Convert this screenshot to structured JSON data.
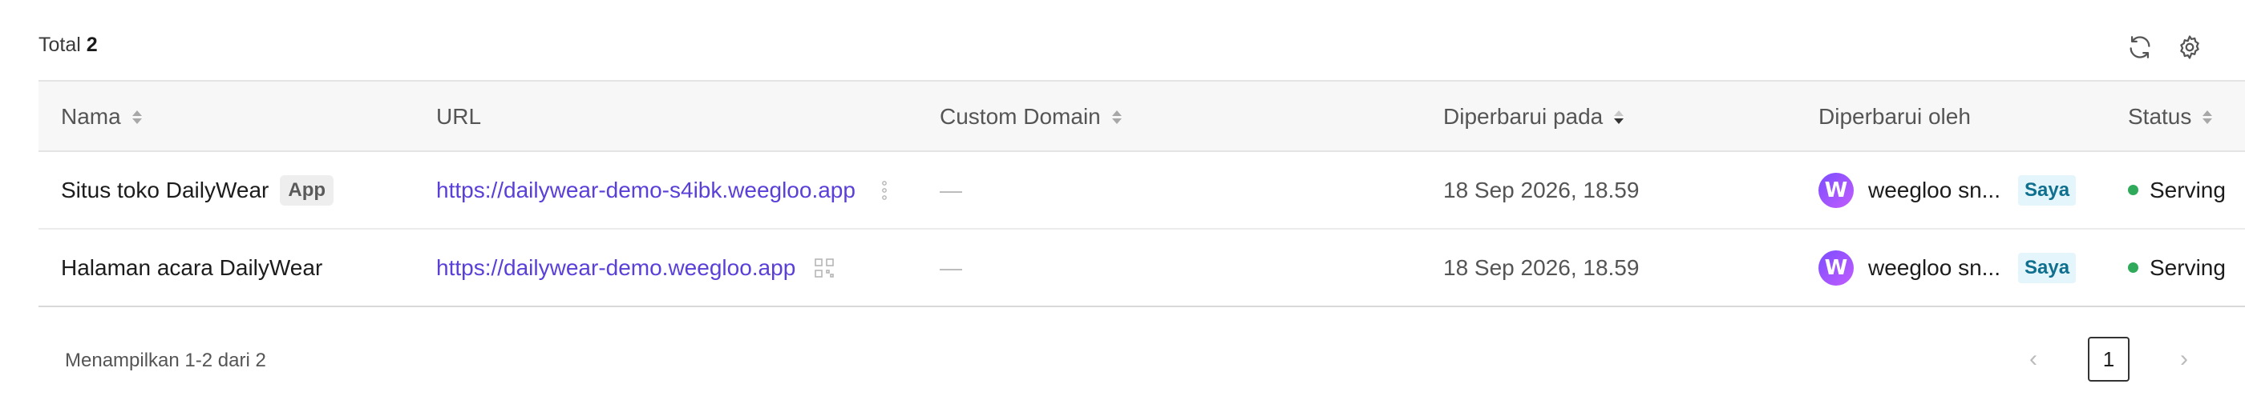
{
  "toolbar": {
    "total_label": "Total",
    "total_count": "2",
    "refresh_icon": "refresh-icon",
    "settings_icon": "gear-icon"
  },
  "table": {
    "columns": [
      {
        "label": "Nama",
        "sortable": true,
        "active": false
      },
      {
        "label": "URL",
        "sortable": false,
        "active": false
      },
      {
        "label": "Custom Domain",
        "sortable": true,
        "active": false
      },
      {
        "label": "Diperbarui pada",
        "sortable": true,
        "active": true
      },
      {
        "label": "Diperbarui oleh",
        "sortable": false,
        "active": false
      },
      {
        "label": "Status",
        "sortable": true,
        "active": false
      }
    ],
    "rows": [
      {
        "name": "Situs toko DailyWear",
        "badge": "App",
        "url": "https://dailywear-demo-s4ibk.weegloo.app",
        "url_action_icon": "more-vertical-icon",
        "custom_domain": "—",
        "updated_at": "18 Sep 2026, 18.59",
        "avatar_letter": "W",
        "updated_by": "weegloo sn...",
        "me_badge": "Saya",
        "status": "Serving"
      },
      {
        "name": "Halaman acara DailyWear",
        "badge": "",
        "url": "https://dailywear-demo.weegloo.app",
        "url_action_icon": "qr-code-icon",
        "custom_domain": "—",
        "updated_at": "18 Sep 2026, 18.59",
        "avatar_letter": "W",
        "updated_by": "weegloo sn...",
        "me_badge": "Saya",
        "status": "Serving"
      }
    ]
  },
  "footer": {
    "showing": "Menampilkan 1-2 dari 2",
    "current_page": "1",
    "prev_symbol": "‹",
    "next_symbol": "›"
  },
  "colors": {
    "link": "#5a3fd8",
    "status_serving": "#2faa5a",
    "me_badge_bg": "#e4f5fb"
  }
}
